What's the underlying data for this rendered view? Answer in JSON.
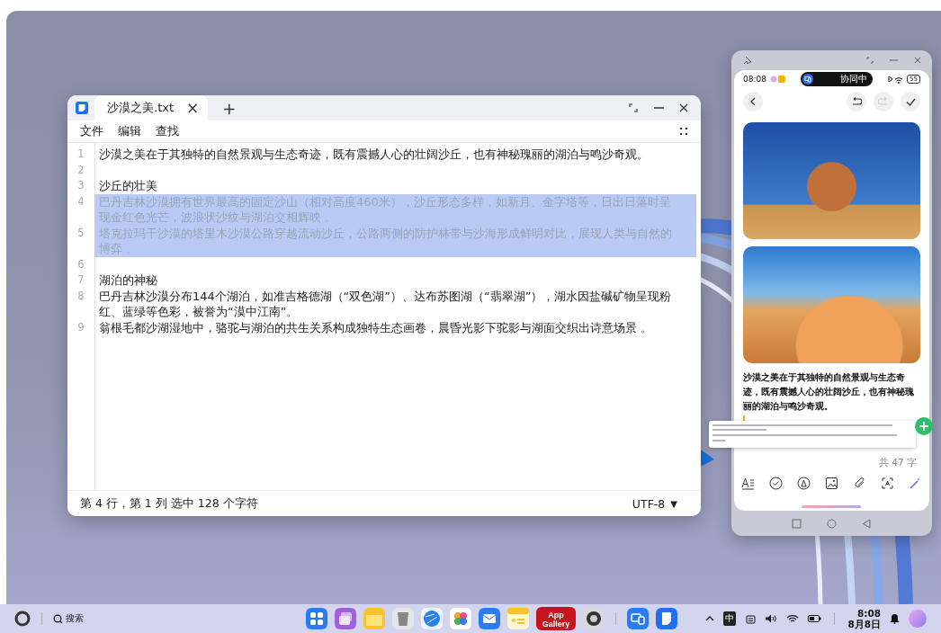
{
  "editor": {
    "tab_title": "沙漠之美.txt",
    "tab_close": "×",
    "new_tab": "+",
    "menu": [
      "文件",
      "编辑",
      "查找"
    ],
    "lines": [
      {
        "number": "1",
        "text": "沙漠之美在于其独特的自然景观与生态奇迹，既有震撼人心的壮阔沙丘，也有神秘瑰丽的湖泊与鸣沙奇观。",
        "selected": false
      },
      {
        "number": "2",
        "selected": false
      },
      {
        "number": "3",
        "text": "沙丘的壮美",
        "selected": false
      },
      {
        "number": "4",
        "text": "巴丹吉林沙漠拥有世界最高的固定沙山（相对高度460米），沙丘形态多样，如新月、金字塔等，日出日落时呈现金红色光芒，波浪状沙纹与湖泊交相辉映 。",
        "selected": true
      },
      {
        "number": "5",
        "text": "塔克拉玛干沙漠的塔里木沙漠公路穿越流动沙丘，公路两侧的防护林带与沙海形成鲜明对比，展现人类与自然的博弈 。",
        "selected": true
      },
      {
        "number": "6",
        "selected": false
      },
      {
        "number": "7",
        "text": "湖泊的神秘",
        "selected": false
      },
      {
        "number": "8",
        "text": "巴丹吉林沙漠分布144个湖泊，如准吉格德湖（“双色湖”）、达布苏图湖（“翡翠湖”），湖水因盐碱矿物呈现粉红、蓝绿等色彩，被誉为“漠中江南”。",
        "selected": false
      },
      {
        "number": "9",
        "text": "翁根毛都沙湖湿地中，骆驼与湖泊的共生关系构成独特生态画卷，晨昏光影下驼影与湖面交织出诗意场景 。",
        "selected": false
      }
    ],
    "status": "第 4 行，第 1 列 选中 128 个字符",
    "encoding": "UTF-8",
    "encoding_caret": "▼"
  },
  "phone": {
    "time": "08:08",
    "collab_label": "协同中",
    "battery": "55",
    "body": "沙漠之美在于其独特的自然景观与生态奇迹，既有震撼人心的壮阔沙丘，也有神秘瑰丽的湖泊与鸣沙奇观。",
    "word_count": "共 47 字"
  },
  "taskbar": {
    "search": "搜索",
    "app_store_label": "App Gallery",
    "ime": "中",
    "time": "8:08",
    "date": "8月8日"
  }
}
